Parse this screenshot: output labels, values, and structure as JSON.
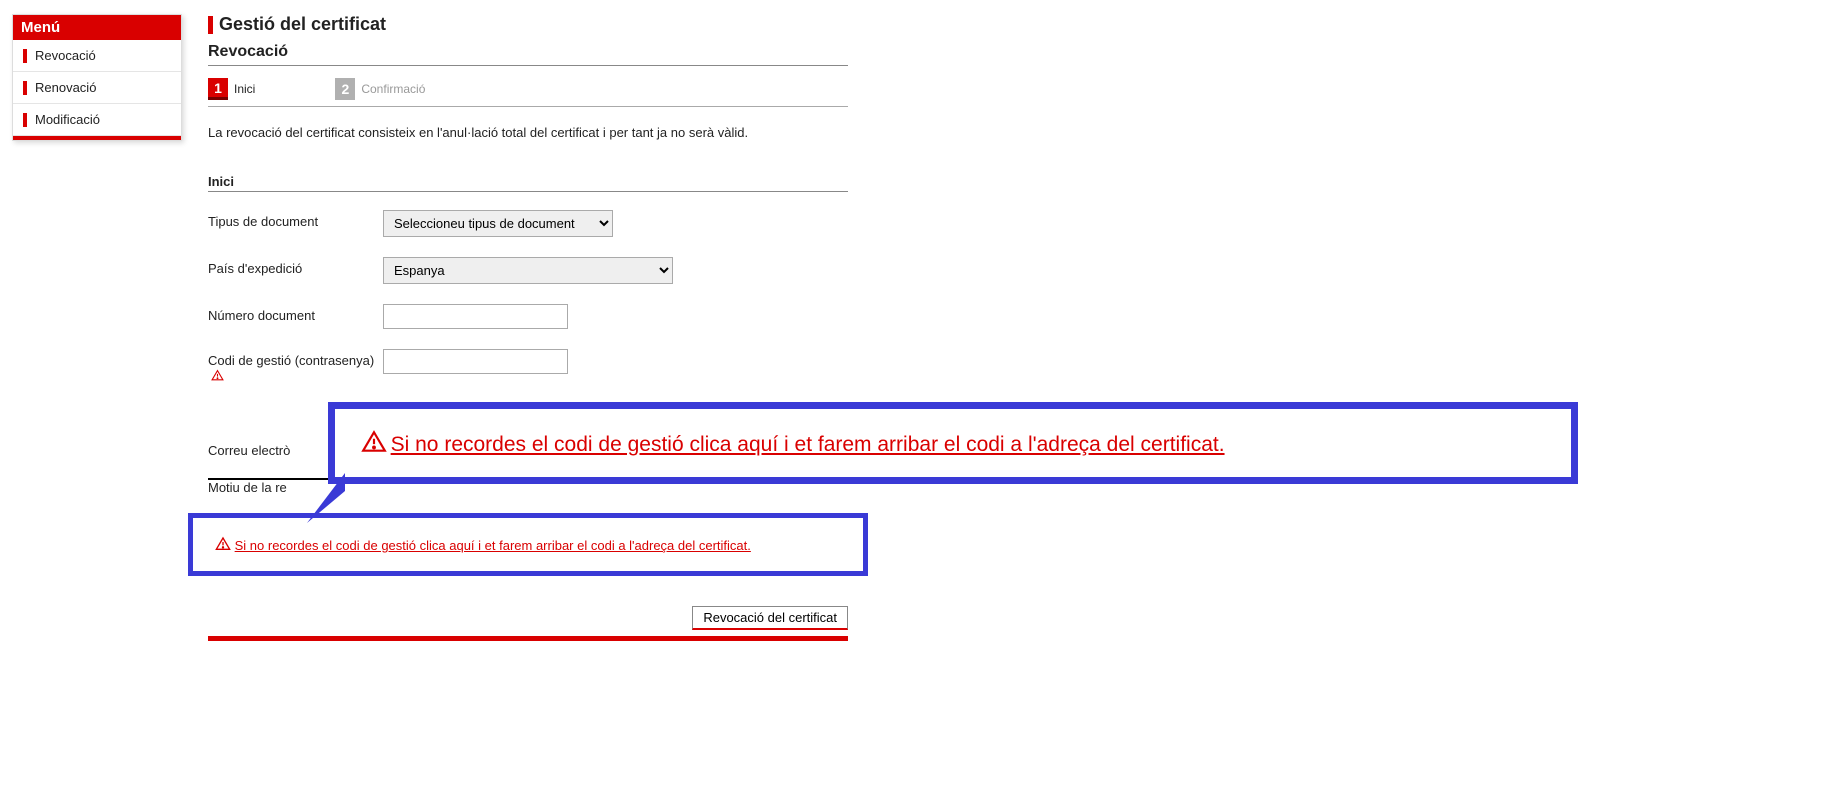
{
  "menu": {
    "title": "Menú",
    "items": [
      "Revocació",
      "Renovació",
      "Modificació"
    ]
  },
  "page": {
    "title": "Gestió del certificat",
    "subtitle": "Revocació"
  },
  "steps": {
    "step1": {
      "num": "1",
      "label": "Inici"
    },
    "step2": {
      "num": "2",
      "label": "Confirmació"
    }
  },
  "intro": "La revocació del certificat consisteix en l'anul·lació total del certificat i per tant ja no serà vàlid.",
  "section": {
    "title": "Inici"
  },
  "form": {
    "doc_type_label": "Tipus de document",
    "doc_type_value": "Seleccioneu tipus de document",
    "country_label": "País d'expedició",
    "country_value": "Espanya",
    "doc_num_label": "Número document",
    "doc_num_value": "",
    "code_label": "Codi de gestió (contrasenya)",
    "code_value": "",
    "email_label": "Correu electrò",
    "motiu_label": "Motiu de la re"
  },
  "callout": {
    "text": "Si no recordes el codi de gestió clica aquí i et farem arribar el codi a l'adreça del certificat."
  },
  "submit": {
    "label": "Revocació del certificat"
  }
}
